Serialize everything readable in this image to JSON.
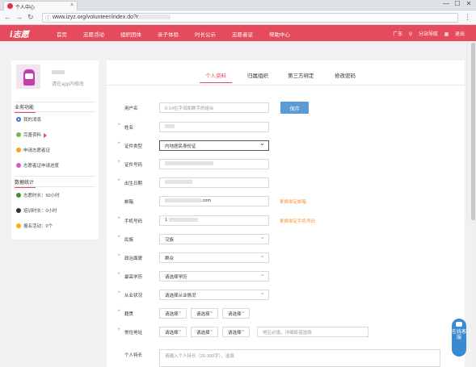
{
  "browser": {
    "tab_title": "个人中心",
    "url": "www.izyz.org/volunteer/index.do?r",
    "window_buttons": [
      "—",
      "☐",
      "✕"
    ]
  },
  "site": {
    "logo_text": "i志愿",
    "nav": [
      "首页",
      "志愿活动",
      "组织团体",
      "亲子体验",
      "时长公示",
      "志愿者证",
      "帮助中心"
    ],
    "city": "广东",
    "station": "分站导航",
    "grid_icon": "▦",
    "logout": "退出"
  },
  "profile": {
    "hint": "请在app内修改"
  },
  "sidebar": {
    "business_title": "业务功能",
    "business_items": [
      {
        "label": "我的消息",
        "color": "#3f6fd8"
      },
      {
        "label": "完善资料",
        "color": "#7ab648"
      },
      {
        "label": "申请志愿者证",
        "color": "#f5a623"
      },
      {
        "label": "志愿者证申请进度",
        "color": "#d45ac8"
      }
    ],
    "stats_title": "数据统计",
    "stats_items": [
      {
        "label": "志愿时长：50小时",
        "color": "#4c8a2e",
        "glyph": "◷"
      },
      {
        "label": "培训时长：0小时",
        "color": "#333333",
        "glyph": "B"
      },
      {
        "label": "报名活动：0个",
        "color": "#f5b400",
        "glyph": "V"
      }
    ]
  },
  "tabs": [
    "个人资料",
    "归属组织",
    "第三方绑定",
    "修改密码"
  ],
  "form": {
    "username_label": "用户名",
    "username_placeholder": "6-14位字母和数字的组合",
    "save_label": "保存",
    "name_label": "姓名",
    "idtype_label": "证件类型",
    "idtype_value": "内地居民身份证",
    "idno_label": "证件号码",
    "birth_label": "出生日期",
    "email_label": "邮箱",
    "email_suffix": ".com",
    "email_link": "更换绑定邮箱",
    "phone_label": "手机号码",
    "phone_prefix": "1",
    "phone_link": "更换绑定手机号码",
    "ethnic_label": "民族",
    "ethnic_value": "汉族",
    "politic_label": "政治面貌",
    "politic_value": "群众",
    "edu_label": "最高学历",
    "edu_value": "请选择学历",
    "job_label": "从业状况",
    "job_value": "请选择从业情况",
    "native_label": "籍贯",
    "select_placeholder": "请选择",
    "address_label": "常住地址",
    "address_placeholder": "地区必填，详细街道选填",
    "intro_label": "个人特长",
    "intro_placeholder": "请输入个人特长（20-300字），选填"
  },
  "service": {
    "label": "在线客服"
  }
}
